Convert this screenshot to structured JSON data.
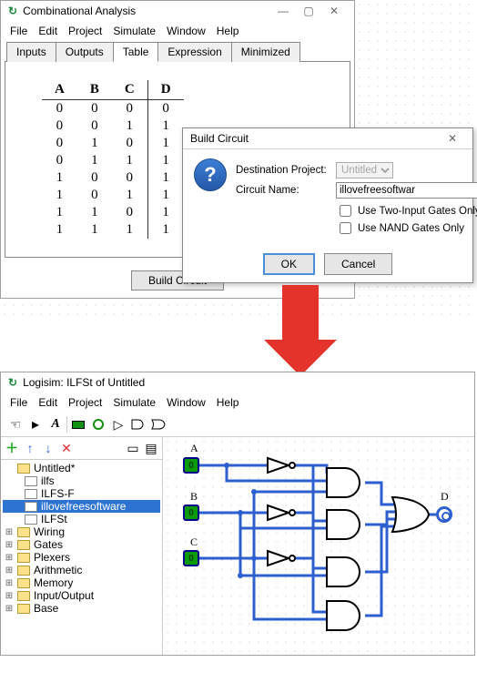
{
  "top_window": {
    "title": "Combinational Analysis",
    "menu": [
      "File",
      "Edit",
      "Project",
      "Simulate",
      "Window",
      "Help"
    ],
    "tabs": [
      "Inputs",
      "Outputs",
      "Table",
      "Expression",
      "Minimized"
    ],
    "active_tab": "Table",
    "truth_table": {
      "headers": [
        "A",
        "B",
        "C",
        "D"
      ],
      "rows": [
        [
          "0",
          "0",
          "0",
          "0"
        ],
        [
          "0",
          "0",
          "1",
          "1"
        ],
        [
          "0",
          "1",
          "0",
          "1"
        ],
        [
          "0",
          "1",
          "1",
          "1"
        ],
        [
          "1",
          "0",
          "0",
          "1"
        ],
        [
          "1",
          "0",
          "1",
          "1"
        ],
        [
          "1",
          "1",
          "0",
          "1"
        ],
        [
          "1",
          "1",
          "1",
          "1"
        ]
      ]
    },
    "build_button": "Build Circuit"
  },
  "dialog": {
    "title": "Build Circuit",
    "dest_label": "Destination Project:",
    "dest_value": "Untitled",
    "name_label": "Circuit Name:",
    "name_value": "illovefreesoftwar",
    "cb1": "Use Two-Input Gates Only",
    "cb2": "Use NAND Gates Only",
    "ok": "OK",
    "cancel": "Cancel"
  },
  "bottom_window": {
    "title": "Logisim: ILFSt of Untitled",
    "menu": [
      "File",
      "Edit",
      "Project",
      "Simulate",
      "Window",
      "Help"
    ],
    "tree": {
      "root": "Untitled*",
      "circuits": [
        "ilfs",
        "ILFS-F",
        "illovefreesoftware",
        "ILFSt"
      ],
      "selected": "illovefreesoftware",
      "libs": [
        "Wiring",
        "Gates",
        "Plexers",
        "Arithmetic",
        "Memory",
        "Input/Output",
        "Base"
      ]
    },
    "pin_labels": {
      "a": "A",
      "b": "B",
      "c": "C",
      "d": "D"
    },
    "pin_values": {
      "a": "0",
      "b": "0",
      "c": "0"
    }
  }
}
